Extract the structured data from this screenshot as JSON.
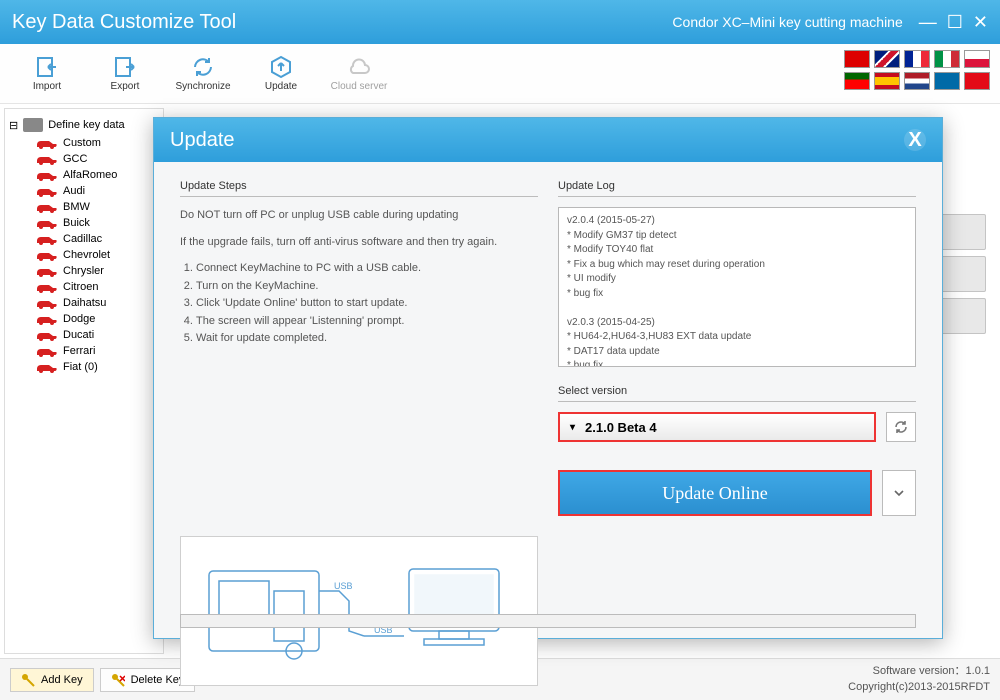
{
  "window": {
    "title": "Key Data Customize Tool",
    "subtitle": "Condor XC–Mini key cutting machine"
  },
  "toolbar": {
    "import": "Import",
    "export": "Export",
    "sync": "Synchronize",
    "update": "Update",
    "cloud": "Cloud server"
  },
  "tree": {
    "root": "Define key data",
    "items": [
      "Custom",
      "GCC",
      "AlfaRomeo",
      "Audi",
      "BMW",
      "Buick",
      "Cadillac",
      "Chevrolet",
      "Chrysler",
      "Citroen",
      "Daihatsu",
      "Dodge",
      "Ducati",
      "Ferrari",
      "Fiat (0)"
    ]
  },
  "modal": {
    "title": "Update",
    "steps_header": "Update Steps",
    "warn1": "Do NOT turn off PC or unplug USB cable during updating",
    "warn2": "If the upgrade fails, turn off anti-virus software and then try again.",
    "steps": [
      "Connect KeyMachine to PC with a USB cable.",
      "Turn on the KeyMachine.",
      "Click 'Update Online' button to start update.",
      "The screen will appear 'Listenning' prompt.",
      "Wait for update completed."
    ],
    "log_header": "Update Log",
    "log_entries": [
      "v2.0.4          (2015-05-27)",
      "* Modify GM37 tip detect",
      "* Modify TOY40 flat",
      "* Fix a bug which may reset during operation",
      "* UI modify",
      "* bug fix",
      "",
      "v2.0.3          (2015-04-25)",
      "* HU64-2,HU64-3,HU83 EXT data update",
      "* DAT17 data update",
      "* bug fix"
    ],
    "select_version_header": "Select version",
    "selected_version": "2.1.0 Beta 4",
    "update_button": "Update Online",
    "usb_label": "USB"
  },
  "footer": {
    "add": "Add Key",
    "delete": "Delete Key",
    "version_label": "Software version：1.0.1",
    "copyright": "Copyright(c)2013-2015RFDT"
  }
}
